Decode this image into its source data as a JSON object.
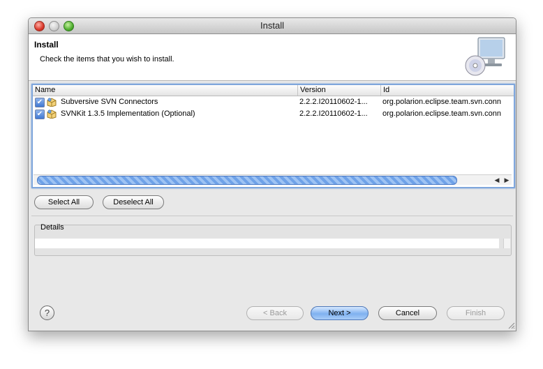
{
  "window": {
    "title": "Install"
  },
  "header": {
    "title": "Install",
    "description": "Check the items that you wish to install.",
    "icon": "install-cd-monitor-icon"
  },
  "table": {
    "columns": [
      "Name",
      "Version",
      "Id"
    ],
    "rows": [
      {
        "checked": true,
        "name": "Subversive SVN Connectors",
        "version": "2.2.2.I20110602-1...",
        "id": "org.polarion.eclipse.team.svn.conn"
      },
      {
        "checked": true,
        "name": "SVNKit 1.3.5 Implementation (Optional)",
        "version": "2.2.2.I20110602-1...",
        "id": "org.polarion.eclipse.team.svn.conn"
      }
    ]
  },
  "buttons": {
    "select_all": "Select All",
    "deselect_all": "Deselect All",
    "back": "< Back",
    "next": "Next >",
    "cancel": "Cancel",
    "finish": "Finish"
  },
  "details": {
    "label": "Details"
  },
  "help": {
    "glyph": "?"
  },
  "colors": {
    "selection_blue": "#7ea6dc",
    "default_button": "#7fb1f0"
  }
}
